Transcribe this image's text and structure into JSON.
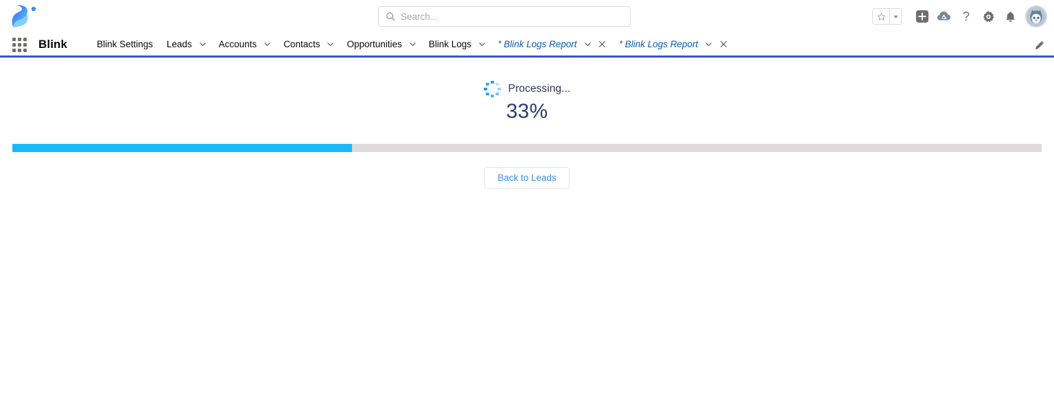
{
  "header": {
    "logo_icon": "blink-logo-icon",
    "search": {
      "placeholder": "Search...",
      "value": "",
      "icon": "search-icon"
    },
    "actions": {
      "favorites_icon": "star-outline-icon",
      "favorites_caret_icon": "chevron-down-icon",
      "add_icon": "plus-square-icon",
      "trailhead_icon": "cloud-mountain-icon",
      "help_icon": "question-mark-icon",
      "setup_icon": "gear-icon",
      "notifications_icon": "bell-icon",
      "avatar_icon": "user-avatar-icon"
    }
  },
  "nav": {
    "app_launcher_icon": "app-launcher-waffle-icon",
    "app_name": "Blink",
    "edit_icon": "pencil-edit-icon",
    "items": [
      {
        "label": "Blink Settings",
        "has_chevron": false,
        "closable": false,
        "unsaved": false
      },
      {
        "label": "Leads",
        "has_chevron": true,
        "closable": false,
        "unsaved": false
      },
      {
        "label": "Accounts",
        "has_chevron": true,
        "closable": false,
        "unsaved": false
      },
      {
        "label": "Contacts",
        "has_chevron": true,
        "closable": false,
        "unsaved": false
      },
      {
        "label": "Opportunities",
        "has_chevron": true,
        "closable": false,
        "unsaved": false
      },
      {
        "label": "Blink Logs",
        "has_chevron": true,
        "closable": false,
        "unsaved": false
      },
      {
        "label": "Blink Logs Report",
        "has_chevron": true,
        "closable": true,
        "unsaved": true
      },
      {
        "label": "Blink Logs Report",
        "has_chevron": true,
        "closable": true,
        "unsaved": true
      }
    ],
    "unsaved_marker": "*",
    "close_icon": "close-x-icon",
    "chevron_icon": "chevron-down-icon"
  },
  "main": {
    "spinner_icon": "loading-spinner-icon",
    "status_text": "Processing...",
    "percent_label": "33%",
    "progress_value": 33,
    "progress_max": 100,
    "back_button_label": "Back to Leads"
  },
  "colors": {
    "accent_blue": "#1ab9ff",
    "nav_underline": "#3b4ee0",
    "link_blue": "#0b5cab",
    "progress_track": "#dddbda",
    "heading_navy": "#2b3a73"
  }
}
